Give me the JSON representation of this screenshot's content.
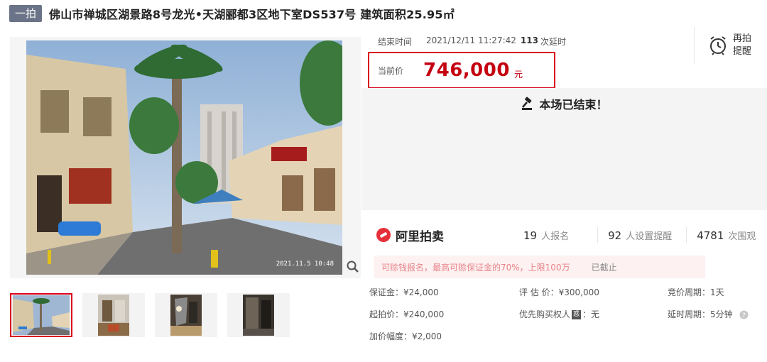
{
  "header": {
    "round_badge": "一拍",
    "title": "佛山市禅城区湖景路8号龙光•天湖郦都3区地下室DS537号 建筑面积25.95㎡"
  },
  "gallery": {
    "main_photo_date": "2021.11.5 10:48",
    "thumbnail_count": 4
  },
  "auction_info": {
    "end_time_label": "结束时间",
    "end_time_value": "2021/12/11 11:27:42",
    "delay_count": "113",
    "delay_label": "次延时",
    "current_price_label": "当前价",
    "current_price_value": "746,000",
    "current_price_unit": "元",
    "reminder_label": "再拍提醒",
    "ended_message": "本场已结束！"
  },
  "platform": {
    "logo_text": "阿里拍卖"
  },
  "stats": [
    {
      "value": "19",
      "label": "人报名"
    },
    {
      "value": "92",
      "label": "人设置提醒"
    },
    {
      "value": "4781",
      "label": "次围观"
    }
  ],
  "notice": {
    "message": "可赊钱报名，最高可赊保证金的70%，上限100万",
    "status": "已截止"
  },
  "details": {
    "deposit": "保证金：¥24,000",
    "appraisal": "评 估 价：¥300,000",
    "bid_cycle": "竞价周期：1天",
    "start_price": "起拍价：¥240,000",
    "priority_buyer_prefix": "优先购买权人",
    "priority_buyer_icon": "惑",
    "priority_buyer_value": "：无",
    "delay_cycle": "延时周期：5分钟",
    "increment": "加价幅度：¥2,000"
  },
  "colors": {
    "accent_red": "#c40010",
    "border_red": "#d9001b",
    "badge_gray": "#6a7387"
  }
}
